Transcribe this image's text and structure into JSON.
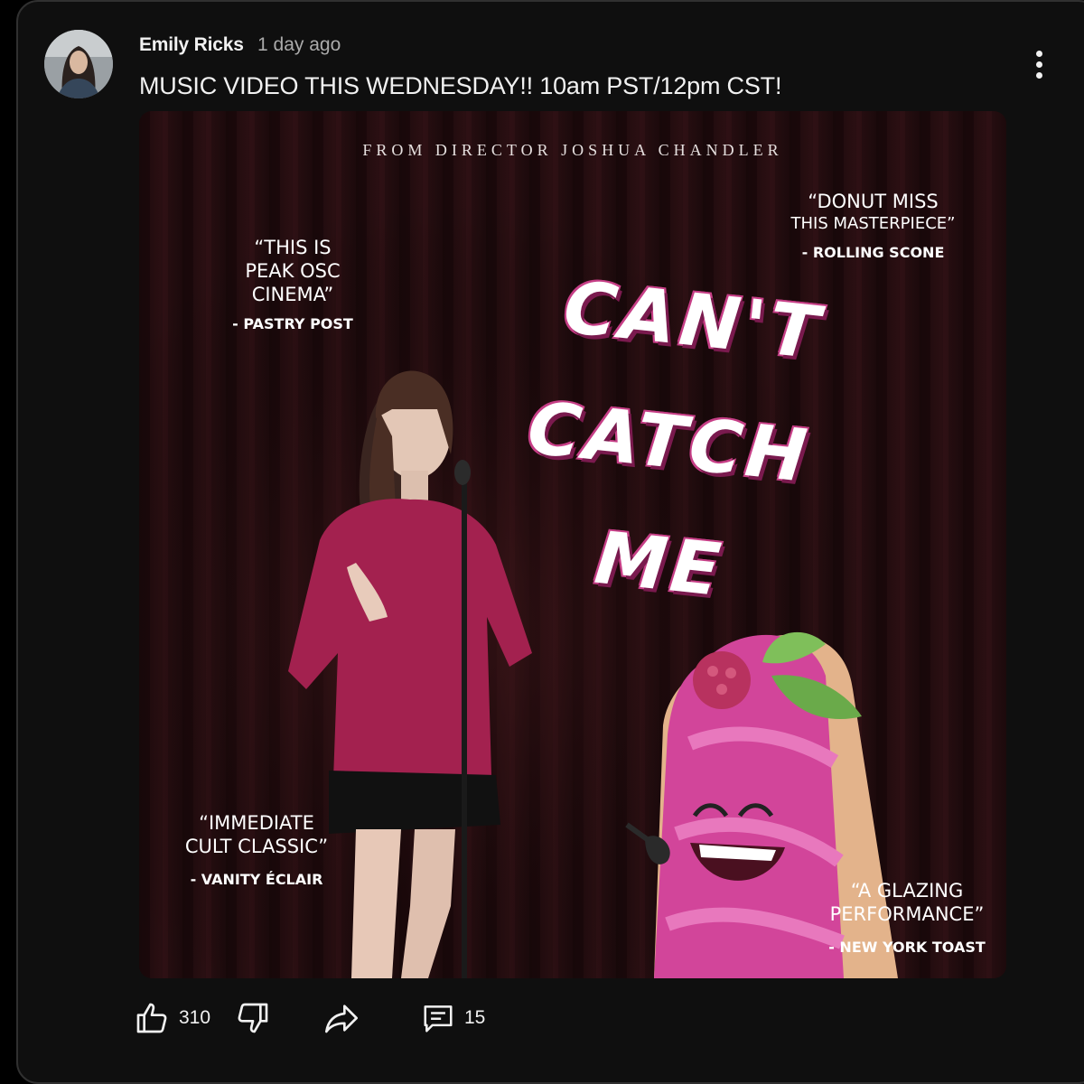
{
  "post": {
    "author": "Emily Ricks",
    "time": "1 day ago",
    "text": "MUSIC VIDEO THIS WEDNESDAY!! 10am PST/12pm CST!"
  },
  "poster": {
    "director_line": "FROM DIRECTOR JOSHUA CHANDLER",
    "title_lines": [
      "CAN'T",
      "CATCH",
      "ME"
    ],
    "reviews": [
      {
        "quote_lines": [
          "“THIS IS",
          "PEAK OSC",
          "CINEMA”"
        ],
        "source": "- PASTRY POST"
      },
      {
        "quote_lines": [
          "“DONUT MISS",
          "THIS MASTERPIECE”"
        ],
        "source": "- ROLLING SCONE"
      },
      {
        "quote_lines": [
          "“IMMEDIATE",
          "CULT CLASSIC”"
        ],
        "source": "- VANITY ÉCLAIR"
      },
      {
        "quote_lines": [
          "“A GLAZING",
          "PERFORMANCE”"
        ],
        "source": "- NEW YORK TOAST"
      }
    ]
  },
  "actions": {
    "like_count": "310",
    "comment_count": "15"
  },
  "colors": {
    "card_bg": "#0f0f0f",
    "card_border": "#303030",
    "text_primary": "#f1f1f1",
    "text_secondary": "#aaaaaa",
    "title_pink": "#c63e86"
  },
  "icons": [
    "more-vert-icon",
    "thumb-up-icon",
    "thumb-down-icon",
    "share-icon",
    "comment-icon"
  ]
}
